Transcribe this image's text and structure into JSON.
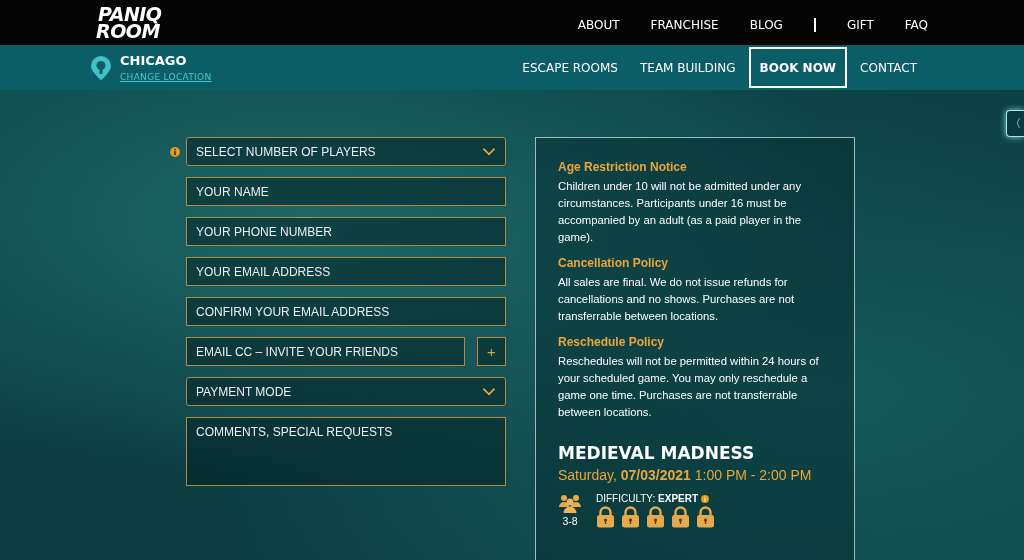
{
  "logo": {
    "line_1": "PANIQ",
    "line_2": "ROOM"
  },
  "top_nav": [
    {
      "label": "ABOUT"
    },
    {
      "label": "FRANCHISE"
    },
    {
      "label": "BLOG"
    },
    {
      "label": "GIFT",
      "divider_before": true
    },
    {
      "label": "FAQ"
    }
  ],
  "location": {
    "city": "CHICAGO",
    "link": "CHANGE LOCATION"
  },
  "main_nav": [
    {
      "label": "ESCAPE ROOMS",
      "kind": "link"
    },
    {
      "label": "TEAM BUILDING",
      "kind": "link"
    },
    {
      "label": "BOOK NOW",
      "kind": "button"
    },
    {
      "label": "CONTACT",
      "kind": "link"
    }
  ],
  "side_tab": {
    "glyph": "〈"
  },
  "form": [
    {
      "kind": "select",
      "placeholder": "SELECT NUMBER OF PLAYERS",
      "info": true
    },
    {
      "kind": "input",
      "placeholder": "YOUR NAME"
    },
    {
      "kind": "input",
      "placeholder": "YOUR PHONE NUMBER"
    },
    {
      "kind": "input",
      "placeholder": "YOUR EMAIL ADDRESS"
    },
    {
      "kind": "input",
      "placeholder": "CONFIRM YOUR EMAIL ADDRESS"
    },
    {
      "kind": "input_add",
      "placeholder": "EMAIL CC – INVITE YOUR FRIENDS",
      "add_label": "+"
    },
    {
      "kind": "select",
      "placeholder": "PAYMENT MODE"
    },
    {
      "kind": "textarea",
      "placeholder": "COMMENTS, SPECIAL REQUESTS"
    }
  ],
  "policies": [
    {
      "heading": "Age Restriction Notice",
      "text": "Children under 10 will not be admitted under any circumstances. Participants under 16 must be accompanied by an adult (as a paid player in the game)."
    },
    {
      "heading": "Cancellation Policy",
      "text": "All sales are final. We do not issue refunds for cancellations and no shows. Purchases are not transferrable between locations."
    },
    {
      "heading": "Reschedule Policy",
      "text": "Reschedules will not be permitted within 24 hours of your scheduled game. You may only reschedule a game one time. Purchases are not transferrable between locations."
    }
  ],
  "booking": {
    "room": "MEDIEVAL MADNESS",
    "when": "Saturday, **07/03/2021** 1:00 PM - 2:00 PM",
    "players": "3-8",
    "difficulty_label": "DIFFICULTY:",
    "difficulty": "EXPERT",
    "stars": 5
  }
}
